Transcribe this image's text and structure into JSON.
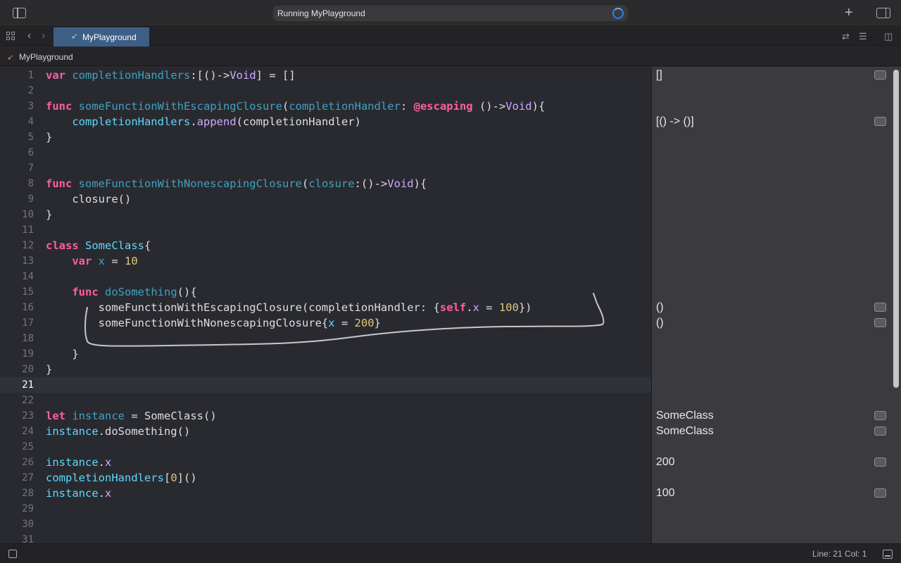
{
  "window": {
    "activity_text": "Running MyPlayground",
    "add_button": "+"
  },
  "tabs": [
    {
      "label": "MyPlayground"
    }
  ],
  "breadcrumb": {
    "label": "MyPlayground"
  },
  "editor": {
    "current_line": 21,
    "lines": [
      {
        "n": "1",
        "tokens": [
          [
            "kw",
            "var"
          ],
          [
            "pl",
            " "
          ],
          [
            "fn",
            "completionHandlers"
          ],
          [
            "pl",
            ":[()->"
          ],
          [
            "tp",
            "Void"
          ],
          [
            "pl",
            "] = []"
          ]
        ]
      },
      {
        "n": "2",
        "tokens": []
      },
      {
        "n": "3",
        "tokens": [
          [
            "kw",
            "func"
          ],
          [
            "pl",
            " "
          ],
          [
            "fn",
            "someFunctionWithEscapingClosure"
          ],
          [
            "pl",
            "("
          ],
          [
            "fn",
            "completionHandler"
          ],
          [
            "pl",
            ": "
          ],
          [
            "kw",
            "@escaping"
          ],
          [
            "pl",
            " ()->"
          ],
          [
            "tp",
            "Void"
          ],
          [
            "pl",
            "){"
          ]
        ]
      },
      {
        "n": "4",
        "tokens": [
          [
            "pl",
            "    "
          ],
          [
            "ty",
            "completionHandlers"
          ],
          [
            "pl",
            "."
          ],
          [
            "tp",
            "append"
          ],
          [
            "pl",
            "(completionHandler)"
          ]
        ]
      },
      {
        "n": "5",
        "tokens": [
          [
            "pl",
            "}"
          ]
        ]
      },
      {
        "n": "6",
        "tokens": []
      },
      {
        "n": "7",
        "tokens": []
      },
      {
        "n": "8",
        "tokens": [
          [
            "kw",
            "func"
          ],
          [
            "pl",
            " "
          ],
          [
            "fn",
            "someFunctionWithNonescapingClosure"
          ],
          [
            "pl",
            "("
          ],
          [
            "fn",
            "closure"
          ],
          [
            "pl",
            ":()->"
          ],
          [
            "tp",
            "Void"
          ],
          [
            "pl",
            "){"
          ]
        ]
      },
      {
        "n": "9",
        "tokens": [
          [
            "pl",
            "    closure()"
          ]
        ]
      },
      {
        "n": "10",
        "tokens": [
          [
            "pl",
            "}"
          ]
        ]
      },
      {
        "n": "11",
        "tokens": []
      },
      {
        "n": "12",
        "tokens": [
          [
            "kw",
            "class"
          ],
          [
            "pl",
            " "
          ],
          [
            "ty",
            "SomeClass"
          ],
          [
            "pl",
            "{"
          ]
        ]
      },
      {
        "n": "13",
        "tokens": [
          [
            "pl",
            "    "
          ],
          [
            "kw",
            "var"
          ],
          [
            "pl",
            " "
          ],
          [
            "fn",
            "x"
          ],
          [
            "pl",
            " = "
          ],
          [
            "num",
            "10"
          ]
        ]
      },
      {
        "n": "14",
        "tokens": []
      },
      {
        "n": "15",
        "tokens": [
          [
            "pl",
            "    "
          ],
          [
            "kw",
            "func"
          ],
          [
            "pl",
            " "
          ],
          [
            "fn",
            "doSomething"
          ],
          [
            "pl",
            "(){"
          ]
        ]
      },
      {
        "n": "16",
        "tokens": [
          [
            "pl",
            "        someFunctionWithEscapingClosure(completionHandler: {"
          ],
          [
            "kw",
            "self"
          ],
          [
            "pl",
            "."
          ],
          [
            "tp",
            "x"
          ],
          [
            "pl",
            " = "
          ],
          [
            "num",
            "100"
          ],
          [
            "pl",
            "})"
          ]
        ]
      },
      {
        "n": "17",
        "tokens": [
          [
            "pl",
            "        someFunctionWithNonescapingClosure{"
          ],
          [
            "ty",
            "x"
          ],
          [
            "pl",
            " = "
          ],
          [
            "num",
            "200"
          ],
          [
            "pl",
            "}"
          ]
        ]
      },
      {
        "n": "18",
        "tokens": []
      },
      {
        "n": "19",
        "tokens": [
          [
            "pl",
            "    }"
          ]
        ]
      },
      {
        "n": "20",
        "tokens": [
          [
            "pl",
            "}"
          ]
        ]
      },
      {
        "n": "21",
        "tokens": []
      },
      {
        "n": "22",
        "tokens": []
      },
      {
        "n": "23",
        "tokens": [
          [
            "kw",
            "let"
          ],
          [
            "pl",
            " "
          ],
          [
            "fn",
            "instance"
          ],
          [
            "pl",
            " = SomeClass()"
          ]
        ]
      },
      {
        "n": "24",
        "tokens": [
          [
            "ty",
            "instance"
          ],
          [
            "pl",
            ".doSomething()"
          ]
        ]
      },
      {
        "n": "25",
        "tokens": []
      },
      {
        "n": "26",
        "tokens": [
          [
            "ty",
            "instance"
          ],
          [
            "pl",
            "."
          ],
          [
            "tp",
            "x"
          ]
        ]
      },
      {
        "n": "27",
        "tokens": [
          [
            "ty",
            "completionHandlers"
          ],
          [
            "pl",
            "["
          ],
          [
            "num",
            "0"
          ],
          [
            "pl",
            "]()"
          ]
        ]
      },
      {
        "n": "28",
        "tokens": [
          [
            "ty",
            "instance"
          ],
          [
            "pl",
            "."
          ],
          [
            "tp",
            "x"
          ]
        ]
      },
      {
        "n": "29",
        "tokens": []
      },
      {
        "n": "30",
        "tokens": []
      },
      {
        "n": "31",
        "tokens": []
      }
    ]
  },
  "results": [
    {
      "line": 1,
      "text": "[]"
    },
    {
      "line": 4,
      "text": "[() -> ()]"
    },
    {
      "line": 16,
      "text": "()"
    },
    {
      "line": 17,
      "text": "()"
    },
    {
      "line": 23,
      "text": "SomeClass"
    },
    {
      "line": 24,
      "text": "SomeClass"
    },
    {
      "line": 26,
      "text": "200"
    },
    {
      "line": 28,
      "text": "100"
    }
  ],
  "status": {
    "position": "Line: 21  Col: 1"
  },
  "colors": {
    "keyword": "#fc5fa3",
    "type": "#5dd8ff",
    "function": "#41a1c0",
    "member": "#d0a8ff",
    "number": "#d9c97c",
    "tab_active": "#3d5f86"
  }
}
